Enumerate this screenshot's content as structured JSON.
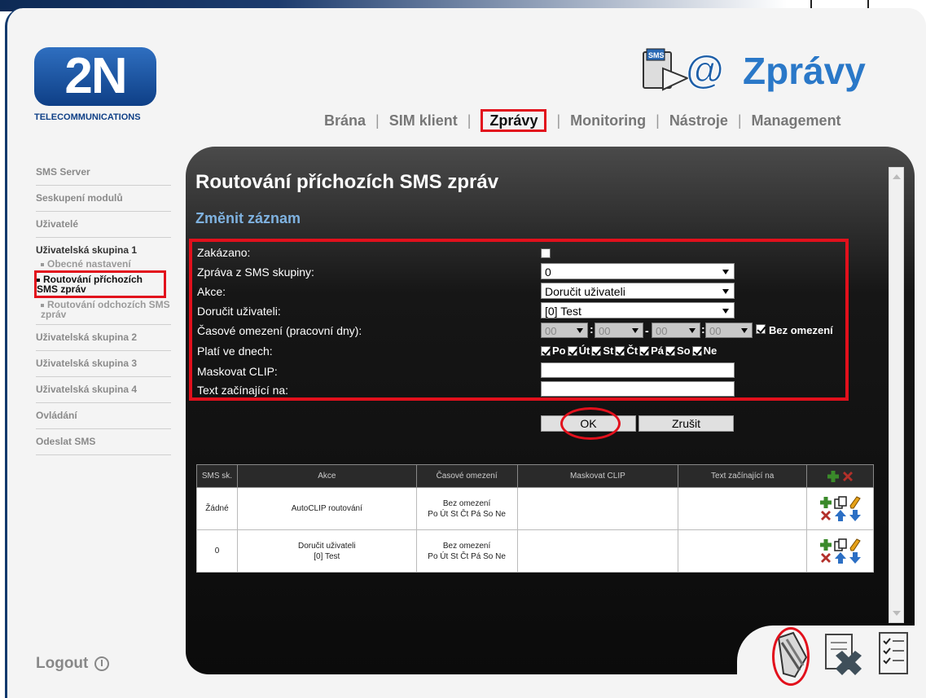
{
  "brand": {
    "logo_text": "2N",
    "logo_subtitle": "TELECOMMUNICATIONS"
  },
  "header": {
    "title": "Zprávy",
    "icon_badge": "SMS"
  },
  "topnav": {
    "items": [
      "Brána",
      "SIM klient",
      "Zprávy",
      "Monitoring",
      "Nástroje",
      "Management"
    ],
    "active": "Zprávy"
  },
  "sidebar": {
    "items": [
      "SMS Server",
      "Seskupení modulů",
      "Uživatelé",
      "Uživatelská skupina 1",
      "Uživatelská skupina 2",
      "Uživatelská skupina 3",
      "Uživatelská skupina 4",
      "Ovládání",
      "Odeslat SMS"
    ],
    "group1_sub": [
      "Obecné nastavení",
      "Routování příchozích SMS zpráv",
      "Routování odchozích SMS zpráv"
    ],
    "logout": "Logout"
  },
  "page": {
    "title": "Routování příchozích SMS zpráv",
    "subtitle": "Změnit záznam"
  },
  "form": {
    "labels": {
      "disabled": "Zakázano:",
      "from_group": "Zpráva z SMS skupiny:",
      "action": "Akce:",
      "deliver_user": "Doručit uživateli:",
      "time_limit": "Časové omezení (pracovní dny):",
      "valid_days": "Platí ve dnech:",
      "mask_clip": "Maskovat CLIP:",
      "text_starts": "Text začínající na:"
    },
    "values": {
      "from_group": "0",
      "action": "Doručit uživateli",
      "deliver_user": "[0] Test",
      "time_from_h": "00",
      "time_from_m": "00",
      "time_to_h": "00",
      "time_to_m": "00",
      "time_sep": "-",
      "colon": ":",
      "unlimited": "Bez omezení"
    },
    "days": [
      "Po",
      "Út",
      "St",
      "Čt",
      "Pá",
      "So",
      "Ne"
    ],
    "ok": "OK",
    "cancel": "Zrušit"
  },
  "table": {
    "headers": [
      "SMS sk.",
      "Akce",
      "Časové omezení",
      "Maskovat CLIP",
      "Text začínající na"
    ],
    "rows": [
      {
        "group": "Žádné",
        "action": "AutoCLIP routování",
        "action2": "",
        "time1": "Bez omezení",
        "time2": "Po Út St Čt Pá So Ne",
        "clip": "",
        "text": ""
      },
      {
        "group": "0",
        "action": "Doručit uživateli",
        "action2": "[0] Test",
        "time1": "Bez omezení",
        "time2": "Po Út St Čt Pá So Ne",
        "clip": "",
        "text": ""
      }
    ]
  },
  "colors": {
    "accent": "#2a78c8",
    "highlight": "#e2101c",
    "panel": "#161616"
  }
}
